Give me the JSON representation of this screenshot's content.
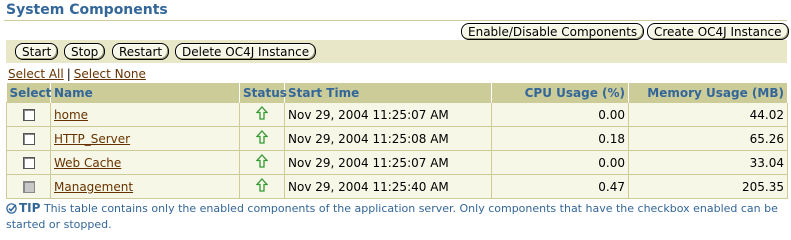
{
  "section": {
    "title": "System Components"
  },
  "top_buttons": {
    "enable_disable": "Enable/Disable Components",
    "create_oc4j": "Create OC4J Instance"
  },
  "toolbar": {
    "start": "Start",
    "stop": "Stop",
    "restart": "Restart",
    "delete_oc4j": "Delete OC4J Instance"
  },
  "select_links": {
    "select_all": "Select All",
    "separator": "|",
    "select_none": "Select None"
  },
  "table": {
    "columns": {
      "select": "Select",
      "name": "Name",
      "status": "Status",
      "start_time": "Start Time",
      "cpu": "CPU Usage (%)",
      "memory": "Memory Usage (MB)"
    },
    "rows": [
      {
        "name": "home",
        "status": "up",
        "start_time": "Nov 29, 2004 11:25:07 AM",
        "cpu": "0.00",
        "memory": "44.02",
        "checkbox_enabled": true
      },
      {
        "name": "HTTP_Server",
        "status": "up",
        "start_time": "Nov 29, 2004 11:25:08 AM",
        "cpu": "0.18",
        "memory": "65.26",
        "checkbox_enabled": true
      },
      {
        "name": "Web Cache",
        "status": "up",
        "start_time": "Nov 29, 2004 11:25:07 AM",
        "cpu": "0.00",
        "memory": "33.04",
        "checkbox_enabled": true
      },
      {
        "name": "Management",
        "status": "up",
        "start_time": "Nov 29, 2004 11:25:40 AM",
        "cpu": "0.47",
        "memory": "205.35",
        "checkbox_enabled": false
      }
    ]
  },
  "tip": {
    "label": "TIP",
    "text": "This table contains only the enabled components of the application server. Only components that have the checkbox enabled can be started or stopped."
  },
  "colors": {
    "header_bg": "#cccc99",
    "header_text": "#336699",
    "row_bg": "#f7f7e7",
    "link": "#663300",
    "status_up": "#339933"
  }
}
